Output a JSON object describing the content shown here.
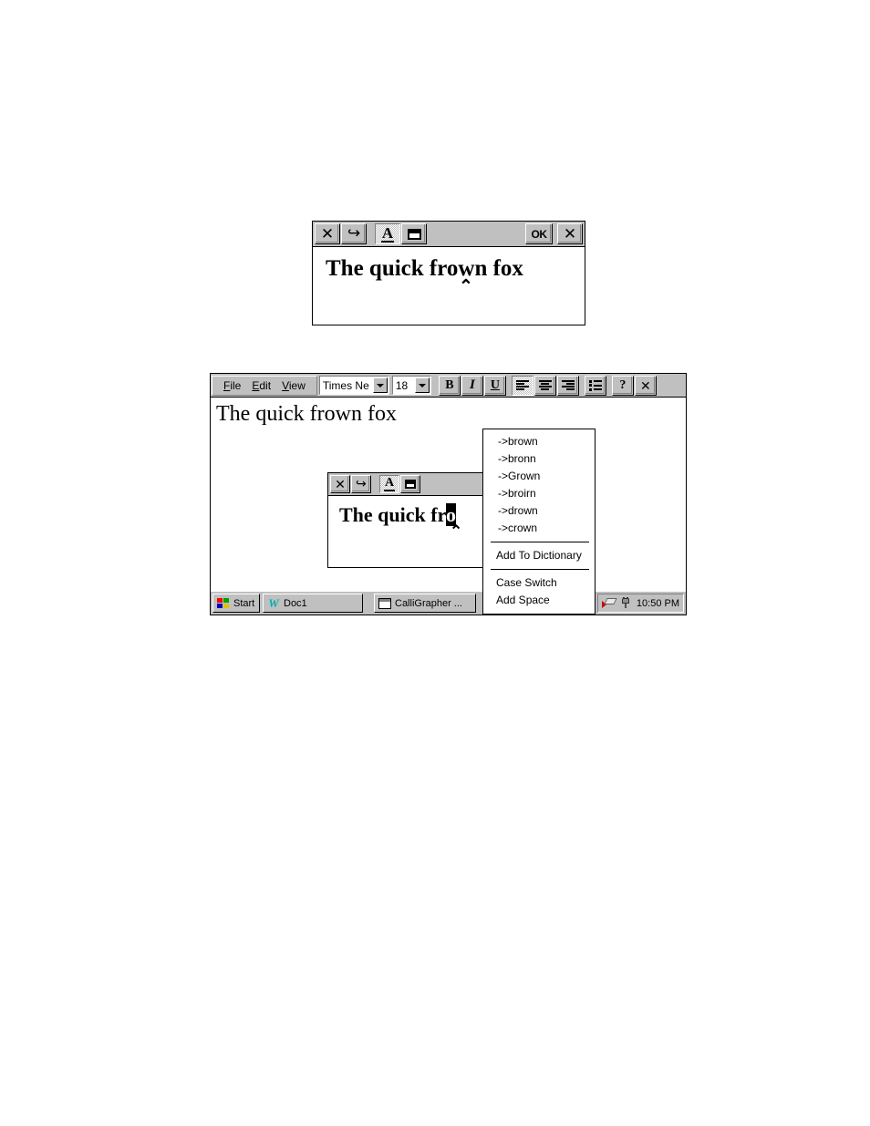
{
  "figure1": {
    "window_name": "CalliGrapher recognition window",
    "toolbar": {
      "close_label": "✕",
      "undo_label": "↩",
      "text_mode_label": "A",
      "window_mode_label": "",
      "ok_label": "OK",
      "dismiss_label": "✕"
    },
    "ink_text": "The quick frown fox",
    "caret_marker": "⌃"
  },
  "figure2": {
    "window_name": "Handheld device screen",
    "menubar": {
      "file": {
        "accel": "F",
        "rest": "ile"
      },
      "edit": {
        "accel": "E",
        "rest": "dit"
      },
      "view": {
        "accel": "V",
        "rest": "iew"
      }
    },
    "font_combo": {
      "value": "Times Ne",
      "name": "font-name-combo"
    },
    "size_combo": {
      "value": "18",
      "name": "font-size-combo"
    },
    "format_buttons": [
      {
        "name": "bold-button",
        "label": "B"
      },
      {
        "name": "italic-button",
        "label": "I"
      },
      {
        "name": "underline-button",
        "label": "U"
      }
    ],
    "align_buttons": [
      {
        "name": "align-left-button",
        "label": "align-left-icon",
        "pressed": true
      },
      {
        "name": "align-center-button",
        "label": "align-center-icon",
        "pressed": false
      },
      {
        "name": "align-right-button",
        "label": "align-right-icon",
        "pressed": false
      }
    ],
    "list_button": {
      "name": "bullet-list-button",
      "label": "bullet-list-icon"
    },
    "help_button": {
      "name": "help-button",
      "label": "?"
    },
    "close_button": {
      "name": "close-button",
      "label": "✕"
    },
    "document_text": "The quick frown fox",
    "inner_window": {
      "toolbar": {
        "close_label": "✕",
        "undo_label": "↩",
        "text_mode_label": "A",
        "window_mode_label": ""
      },
      "ink_text_before": "The quick fr",
      "ink_text_selected": "o",
      "caret_marker": "⌃"
    },
    "taskbar": {
      "start_label": "Start",
      "tasks": [
        {
          "name": "taskbar-item-doc1",
          "label": "Doc1",
          "icon": "word-icon"
        },
        {
          "name": "taskbar-item-calligrapher",
          "label": "CalliGrapher ...",
          "icon": "calligrapher-icon"
        }
      ],
      "tray": {
        "pen_icon": "pen-icon",
        "power_icon": "power-plug-icon",
        "clock": "10:50 PM"
      }
    },
    "context_menu": {
      "name": "spell-correction-context-menu",
      "groups": [
        {
          "items": [
            {
              "label": "->brown"
            },
            {
              "label": "->bronn"
            },
            {
              "label": "->Grown"
            },
            {
              "label": "->broirn"
            },
            {
              "label": "->drown"
            },
            {
              "label": "->crown"
            }
          ]
        },
        {
          "items": [
            {
              "label": "Add To Dictionary"
            }
          ]
        },
        {
          "items": [
            {
              "label": "Case Switch"
            },
            {
              "label": "Add Space"
            }
          ]
        }
      ]
    }
  }
}
